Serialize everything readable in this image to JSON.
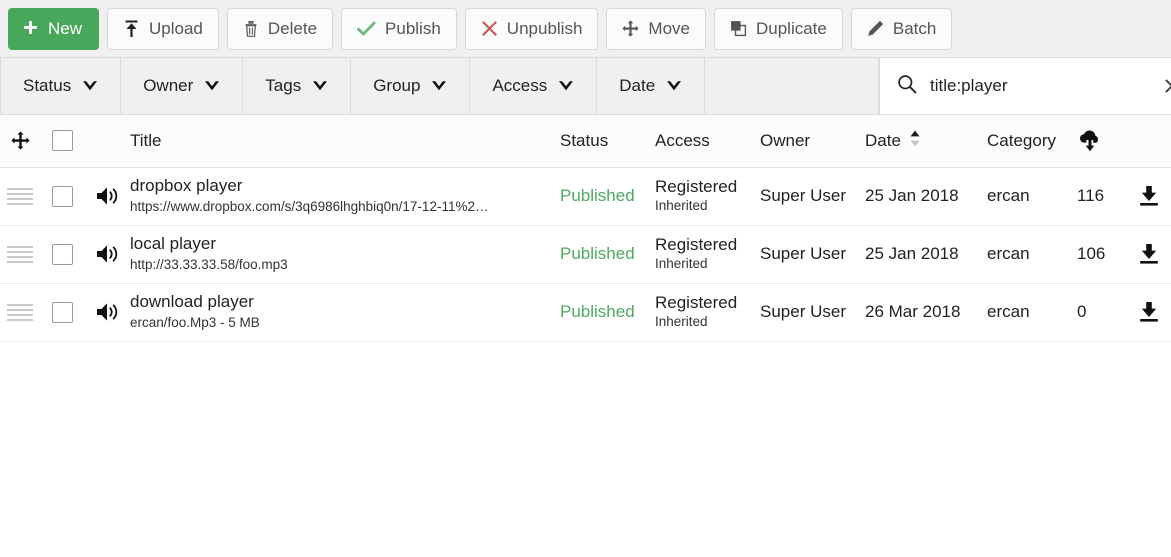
{
  "toolbar": {
    "buttons": [
      {
        "label": "New",
        "icon": "plus-icon",
        "style": "primary"
      },
      {
        "label": "Upload",
        "icon": "upload-icon",
        "style": "default"
      },
      {
        "label": "Delete",
        "icon": "trash-icon",
        "style": "default"
      },
      {
        "label": "Publish",
        "icon": "check-icon",
        "style": "default"
      },
      {
        "label": "Unpublish",
        "icon": "x-icon",
        "style": "default"
      },
      {
        "label": "Move",
        "icon": "move-icon",
        "style": "default"
      },
      {
        "label": "Duplicate",
        "icon": "duplicate-icon",
        "style": "default"
      },
      {
        "label": "Batch",
        "icon": "pencil-icon",
        "style": "default"
      }
    ]
  },
  "filters": [
    {
      "label": "Status"
    },
    {
      "label": "Owner"
    },
    {
      "label": "Tags"
    },
    {
      "label": "Group"
    },
    {
      "label": "Access"
    },
    {
      "label": "Date"
    }
  ],
  "search": {
    "value": "title:player",
    "placeholder": "Search",
    "icon": "search-icon",
    "clear_icon": "close-icon"
  },
  "table": {
    "headers": {
      "drag": "",
      "title": "Title",
      "status": "Status",
      "access": "Access",
      "owner": "Owner",
      "date": "Date",
      "category": "Category",
      "downloads": ""
    },
    "sort": {
      "column": "Date",
      "direction": "asc"
    },
    "rows": [
      {
        "icon": "audio-icon",
        "title": "dropbox player",
        "subtitle": "https://www.dropbox.com/s/3q6986lhghbiq0n/17-12-11%2…",
        "status": "Published",
        "access": "Registered",
        "access_sub": "Inherited",
        "owner": "Super User",
        "date": "25 Jan 2018",
        "category": "ercan",
        "downloads": "116",
        "action_icon": "download-icon"
      },
      {
        "icon": "audio-icon",
        "title": "local player",
        "subtitle": "http://33.33.33.58/foo.mp3",
        "status": "Published",
        "access": "Registered",
        "access_sub": "Inherited",
        "owner": "Super User",
        "date": "25 Jan 2018",
        "category": "ercan",
        "downloads": "106",
        "action_icon": "download-icon"
      },
      {
        "icon": "audio-icon",
        "title": "download player",
        "subtitle": "ercan/foo.Mp3 - 5 MB",
        "status": "Published",
        "access": "Registered",
        "access_sub": "Inherited",
        "owner": "Super User",
        "date": "26 Mar 2018",
        "category": "ercan",
        "downloads": "0",
        "action_icon": "download-icon"
      }
    ]
  },
  "colors": {
    "primary_green": "#49a75b",
    "status_published": "#4fa95f",
    "danger_red": "#c9564f",
    "toolbar_bg": "#f0f0f0"
  }
}
